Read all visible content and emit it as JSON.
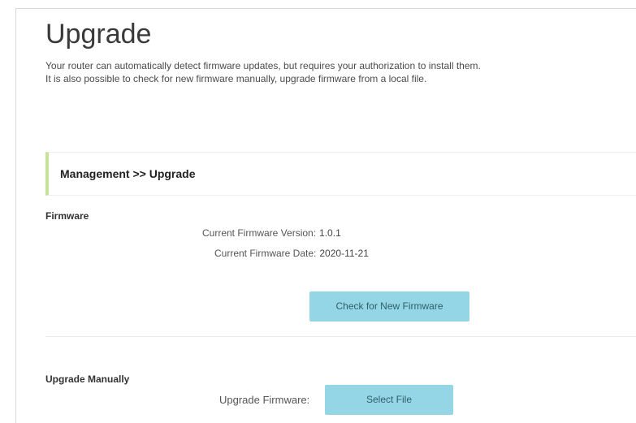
{
  "page": {
    "title": "Upgrade",
    "description_line1": "Your router can automatically detect firmware updates, but requires your authorization to install them.",
    "description_line2": "It is also possible to check for new firmware manually, upgrade firmware from a local file."
  },
  "section": {
    "breadcrumb": "Management >> Upgrade"
  },
  "firmware": {
    "group_label": "Firmware",
    "version_label": "Current Firmware Version:",
    "version_value": "1.0.1",
    "date_label": "Current Firmware Date:",
    "date_value": "2020-11-21",
    "check_button_label": "Check for New Firmware"
  },
  "manual": {
    "group_label": "Upgrade Manually",
    "field_label": "Upgrade Firmware:",
    "select_button_label": "Select File"
  },
  "colors": {
    "accent_bar": "#c7e29a",
    "button_bg": "#94d6e5"
  }
}
